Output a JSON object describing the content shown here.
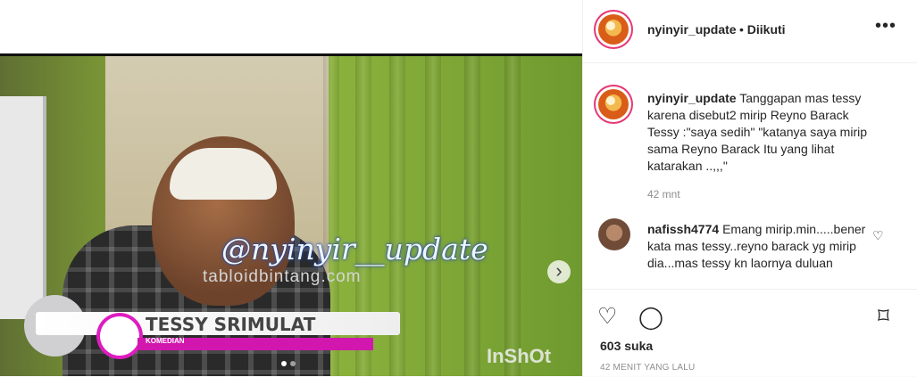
{
  "post": {
    "username": "nyinyir_update",
    "following": "Diikuti",
    "more": "•••"
  },
  "video": {
    "overlay_handle": "@nyinyir__update",
    "source_text": "tabloidbintang.com",
    "lower_third_name": "TESSY SRIMULAT",
    "lower_third_role": "KOMEDIAN",
    "watermark": "InShOt",
    "next_icon": "chevron-right-icon"
  },
  "caption": {
    "username": "nyinyir_update",
    "text": "Tanggapan mas tessy karena disebut2 mirip Reyno Barack Tessy :\"saya sedih\" \"katanya saya mirip sama Reyno Barack Itu yang lihat katarakan ..,,,\"",
    "time": "42 mnt"
  },
  "comments": [
    {
      "username": "nafissh4774",
      "text": "Emang mirip.min.....bener kata mas tessy..reyno barack yg mirip dia...mas tessy kn laornya duluan"
    }
  ],
  "actions": {
    "like_icon": "heart-icon",
    "comment_icon": "comment-icon",
    "save_icon": "bookmark-icon",
    "likes": "603 suka",
    "time_ago": "42 MENIT YANG LALU"
  }
}
